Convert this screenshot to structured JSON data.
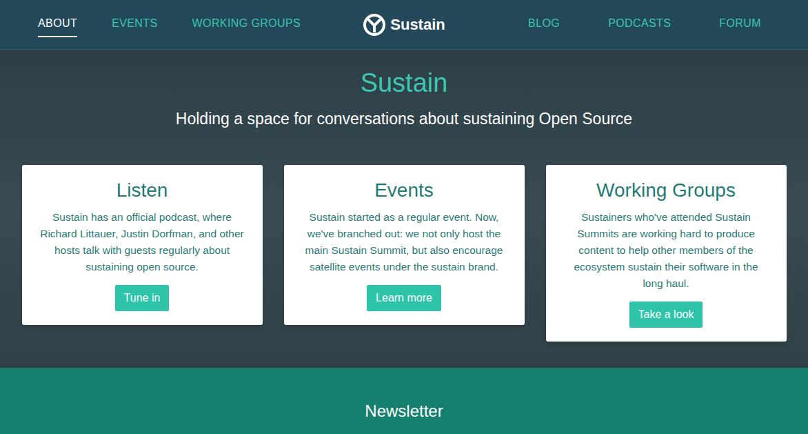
{
  "nav": {
    "left": [
      {
        "label": "ABOUT",
        "selected": true
      },
      {
        "label": "EVENTS",
        "selected": false
      },
      {
        "label": "WORKING GROUPS",
        "selected": false
      }
    ],
    "logo": "Sustain",
    "right": [
      {
        "label": "BLOG",
        "selected": false
      },
      {
        "label": "PODCASTS",
        "selected": false
      },
      {
        "label": "FORUM",
        "selected": false
      }
    ]
  },
  "hero": {
    "title": "Sustain",
    "subtitle": "Holding a space for conversations about sustaining Open Source"
  },
  "cards": [
    {
      "title": "Listen",
      "body": "Sustain has an official podcast, where Richard Littauer, Justin Dorfman, and other hosts talk with guests regularly about sustaining open source.",
      "button": "Tune in"
    },
    {
      "title": "Events",
      "body": "Sustain started as a regular event. Now, we've branched out: we not only host the main Sustain Summit, but also encourage satellite events under the sustain brand.",
      "button": "Learn more"
    },
    {
      "title": "Working Groups",
      "body": "Sustainers who've attended Sustain Summits are working hard to produce content to help other members of the ecosystem sustain their software in the long haul.",
      "button": "Take a look"
    }
  ],
  "newsletter": {
    "title": "Newsletter"
  }
}
